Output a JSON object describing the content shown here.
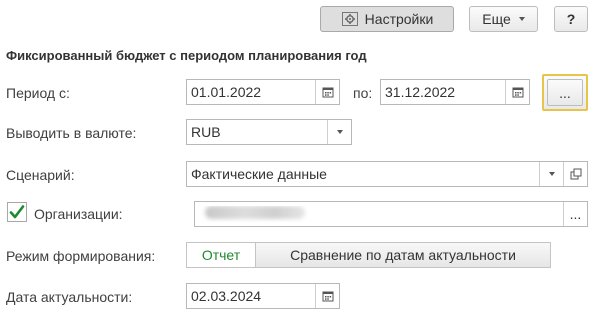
{
  "toolbar": {
    "settings_label": "Настройки",
    "more_label": "Еще",
    "help_label": "?"
  },
  "form": {
    "title": "Фиксированный бюджет с периодом планирования год",
    "period": {
      "label": "Период с:",
      "from_value": "01.01.2022",
      "to_label": "по:",
      "to_value": "31.12.2022",
      "choose_label": "..."
    },
    "currency": {
      "label": "Выводить в валюте:",
      "value": "RUB"
    },
    "scenario": {
      "label": "Сценарий:",
      "value": "Фактические данные"
    },
    "organizations": {
      "label": "Организации:",
      "checked": true,
      "choose_label": "..."
    },
    "mode": {
      "label": "Режим формирования:",
      "options": [
        "Отчет",
        "Сравнение по датам актуальности"
      ],
      "selected": "Отчет"
    },
    "actual_date": {
      "label": "Дата актуальности:",
      "value": "02.03.2024"
    }
  },
  "colors": {
    "accent_green": "#1e8a2e",
    "highlight_border": "#e6c54a"
  }
}
